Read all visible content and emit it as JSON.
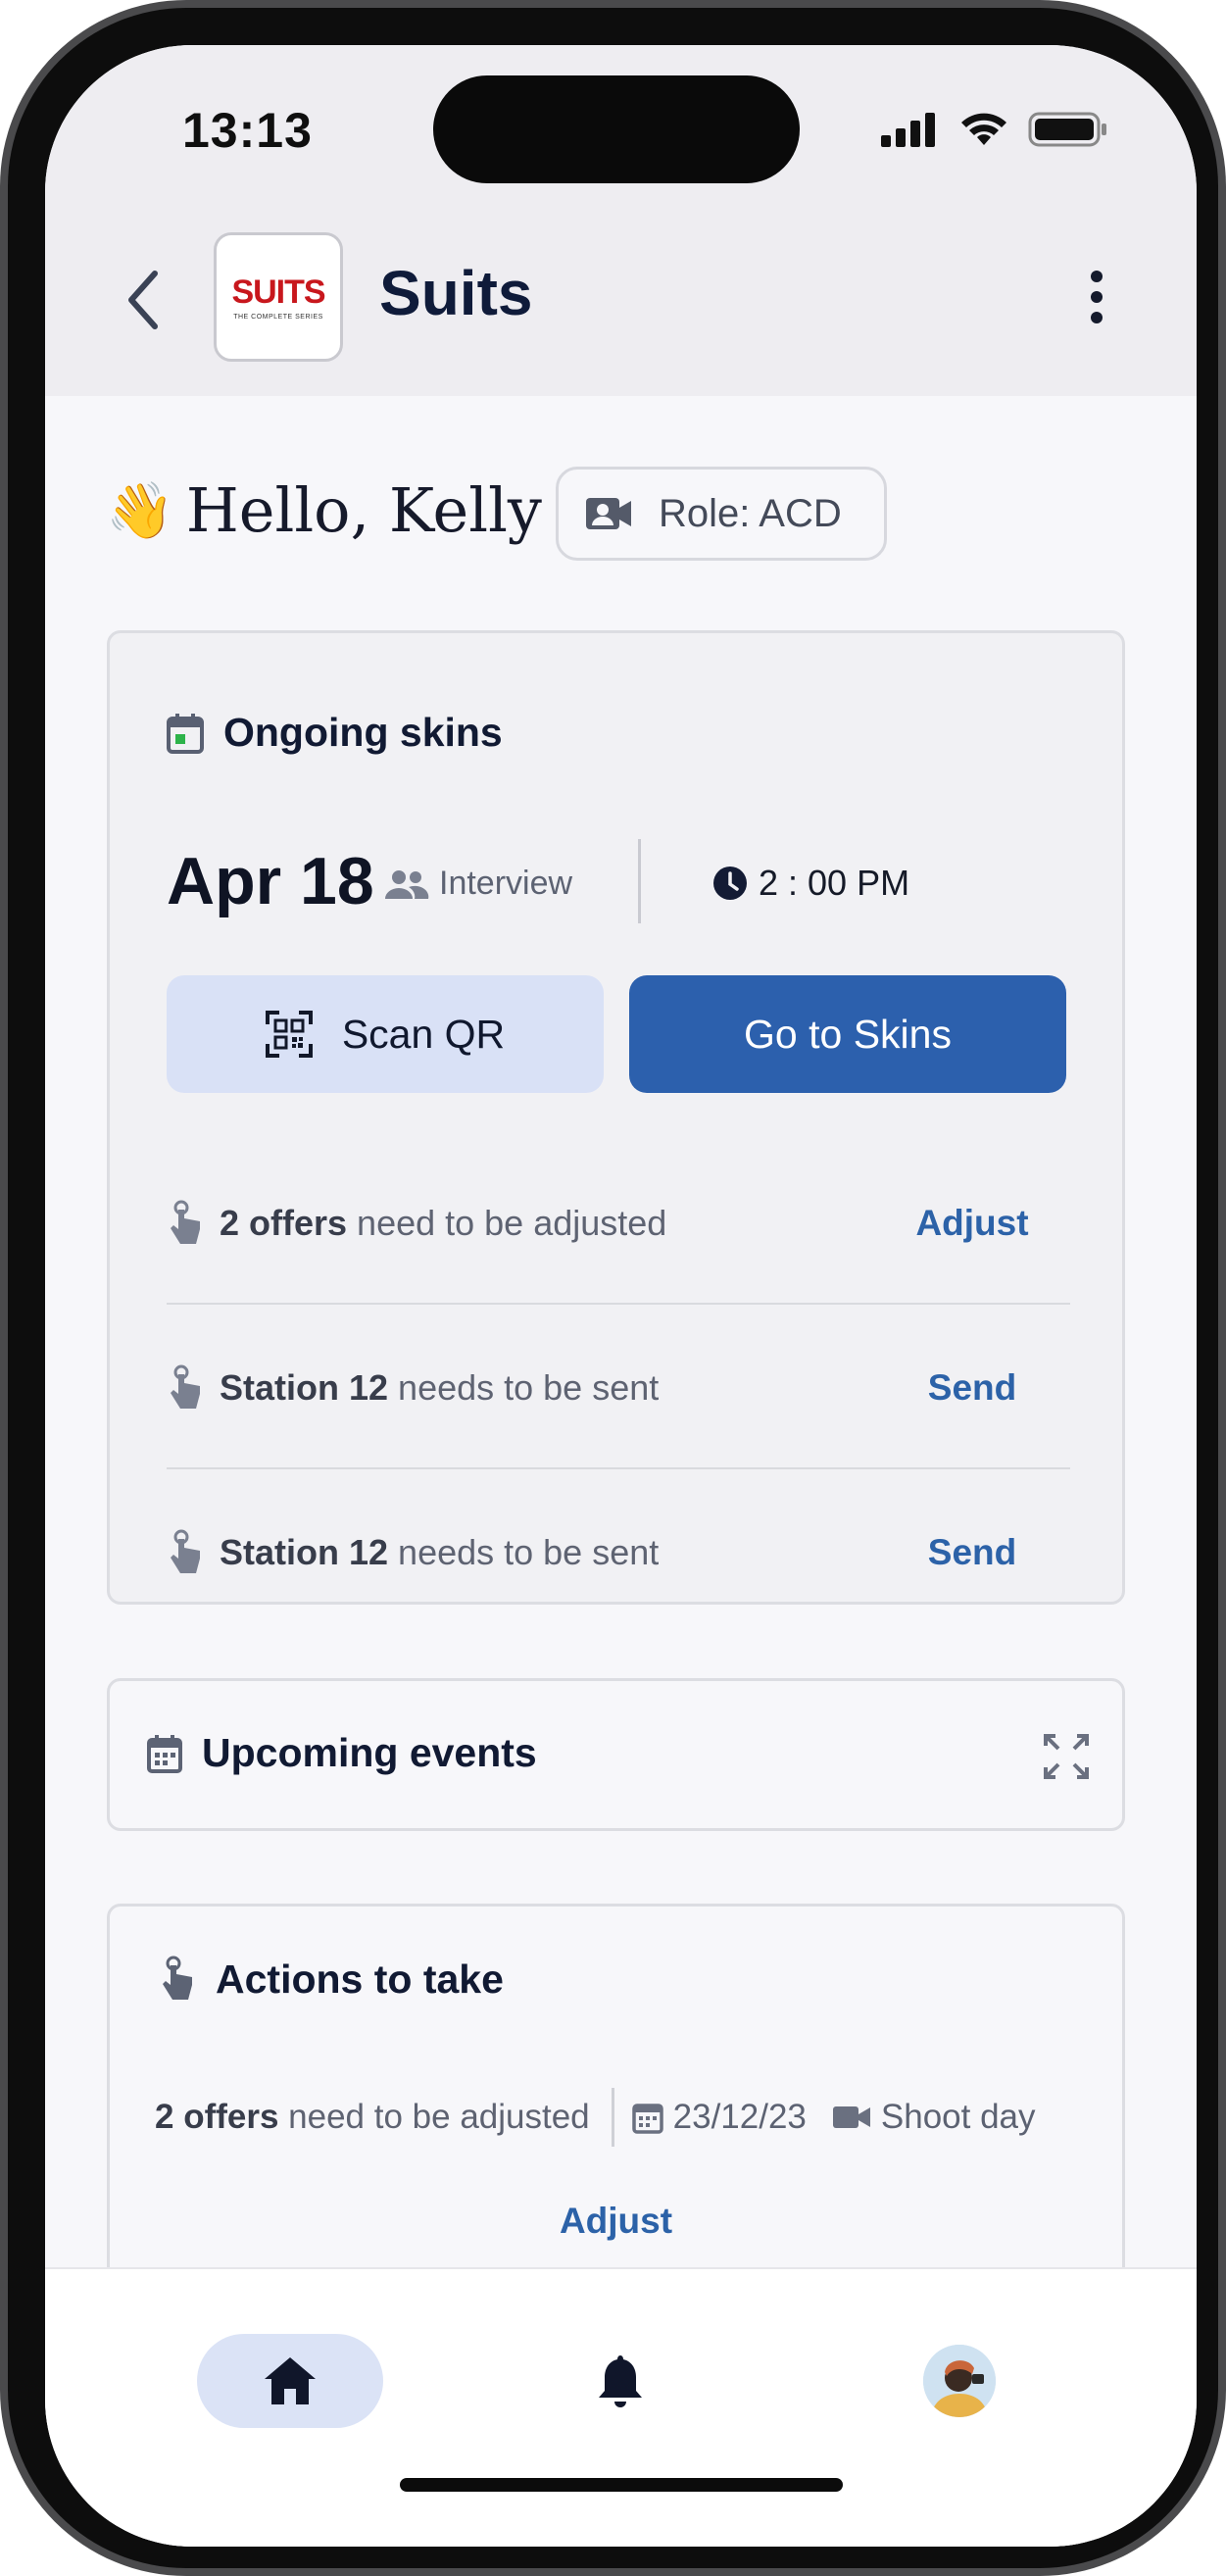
{
  "status_bar": {
    "time": "13:13"
  },
  "header": {
    "show_title": "Suits",
    "logo_word": "SUITS",
    "logo_sub": "THE COMPLETE SERIES"
  },
  "greeting": {
    "emoji": "👋",
    "text": "Hello, Kelly"
  },
  "role_chip": {
    "label": "Role: ACD"
  },
  "ongoing": {
    "title": "Ongoing skins",
    "date": "Apr 18",
    "type": "Interview",
    "time": "2 : 00 PM",
    "scan_label": "Scan QR",
    "go_label": "Go to Skins",
    "items": [
      {
        "bold": "2 offers",
        "rest": " need to be adjusted",
        "action": "Adjust"
      },
      {
        "bold": "Station 12",
        "rest": " needs to be sent",
        "action": "Send"
      },
      {
        "bold": "Station 12",
        "rest": " needs to be sent",
        "action": "Send"
      }
    ]
  },
  "upcoming": {
    "title": "Upcoming events"
  },
  "actions": {
    "title": "Actions to take",
    "item": {
      "bold": "2 offers",
      "rest": " need to be adjusted",
      "date": "23/12/23",
      "event": "Shoot day",
      "action": "Adjust"
    }
  },
  "colors": {
    "primary": "#2c60ad",
    "primary_light": "#d9e1f6",
    "link": "#2c62a8",
    "header_bg": "#eeedf1",
    "brand_red": "#c8171d"
  },
  "icons": {
    "back": "chevron-left-icon",
    "more": "vertical-dots-icon",
    "role": "contact-video-icon",
    "calendar_today": "calendar-today-icon",
    "people": "people-icon",
    "clock": "clock-icon",
    "qr": "qr-scan-icon",
    "touch": "touch-hand-icon",
    "calendar": "calendar-icon",
    "expand": "expand-icon",
    "video": "videocam-icon",
    "home": "home-icon",
    "bell": "bell-icon"
  }
}
